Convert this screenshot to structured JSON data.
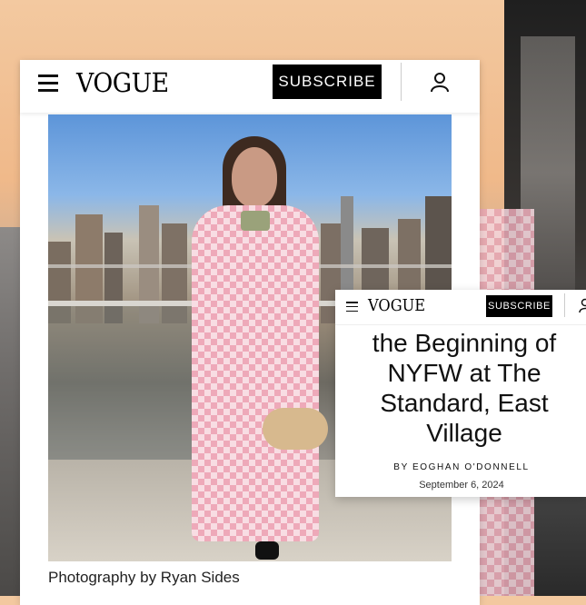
{
  "main_card": {
    "logo": "VOGUE",
    "subscribe_label": "SUBSCRIBE",
    "photo_caption": "Photography by Ryan Sides"
  },
  "overlay_card": {
    "logo": "VOGUE",
    "subscribe_label": "SUBSCRIBE",
    "headline_lines": [
      "the Beginning of",
      "NYFW at The",
      "Standard, East",
      "Village"
    ],
    "byline": "BY EOGHAN O'DONNELL",
    "date": "September 6, 2024"
  },
  "colors": {
    "subscribe_bg": "#000000",
    "coat_pink": "#eea9b9",
    "sky": "#5d95d9"
  }
}
